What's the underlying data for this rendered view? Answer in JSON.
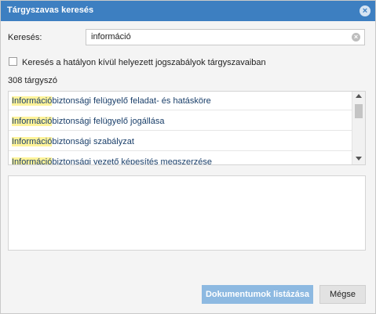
{
  "dialog": {
    "title": "Tárgyszavas keresés",
    "close_symbol": "×"
  },
  "search": {
    "label": "Keresés:",
    "value": "információ",
    "clear_symbol": "×"
  },
  "options": {
    "include_repealed_label": "Keresés a hatályon kívül helyezett jogszabályok tárgyszavaiban"
  },
  "results": {
    "count_text": "308 tárgyszó",
    "items": [
      {
        "match": "Információ",
        "rest": "biztonsági felügyelő feladat- és hatásköre"
      },
      {
        "match": "Információ",
        "rest": "biztonsági felügyelő jogállása"
      },
      {
        "match": "Információ",
        "rest": "biztonsági szabályzat"
      },
      {
        "match": "Információ",
        "rest": "biztonsági vezető képesítés megszerzése"
      }
    ]
  },
  "buttons": {
    "list_documents": "Dokumentumok listázása",
    "cancel": "Mégse"
  },
  "colors": {
    "titlebar": "#3d7fc1",
    "highlight": "#fff39a",
    "primary_button": "#8db9e1"
  }
}
